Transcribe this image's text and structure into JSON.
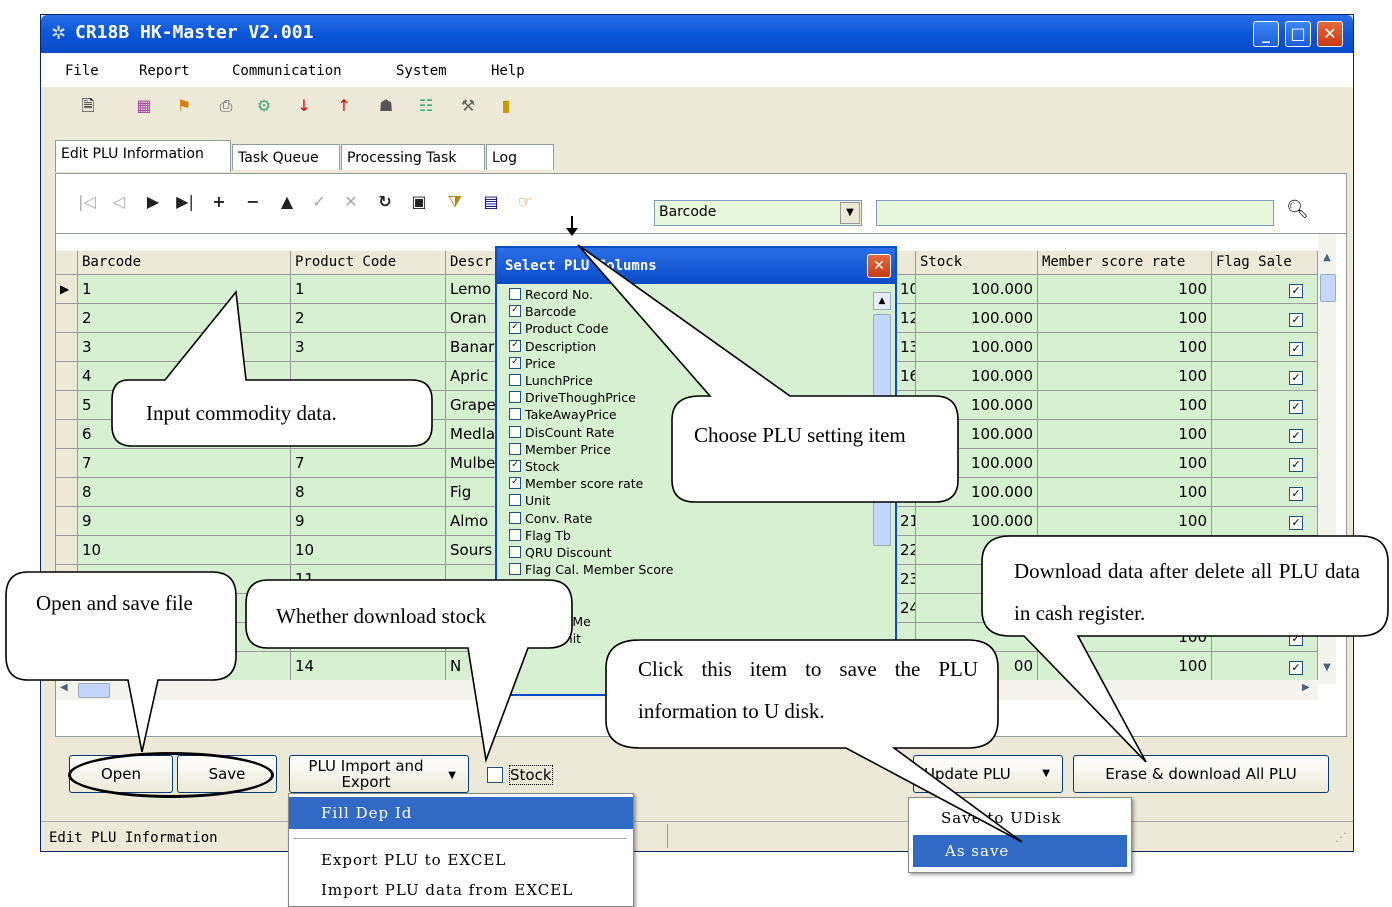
{
  "window": {
    "title": "CR18B HK-Master V2.001"
  },
  "menu": [
    "File",
    "Report",
    "Communication",
    "System",
    "Help"
  ],
  "tabs": [
    "Edit PLU Information",
    "Task Queue",
    "Processing Task",
    "Log"
  ],
  "search": {
    "field": "Barcode",
    "value": ""
  },
  "grid": {
    "columns": [
      "Barcode",
      "Product Code",
      "Descr",
      "Stock",
      "Member score rate",
      "Flag Sale"
    ],
    "rows": [
      {
        "barcode": "1",
        "code": "1",
        "desc": "Lemo",
        "mid": "10",
        "stock": "100.000",
        "rate": "100"
      },
      {
        "barcode": "2",
        "code": "2",
        "desc": "Oran",
        "mid": "12",
        "stock": "100.000",
        "rate": "100"
      },
      {
        "barcode": "3",
        "code": "3",
        "desc": "Banar",
        "mid": "13",
        "stock": "100.000",
        "rate": "100"
      },
      {
        "barcode": "4",
        "code": "",
        "desc": "Apric",
        "mid": "16",
        "stock": "100.000",
        "rate": "100"
      },
      {
        "barcode": "5",
        "code": "",
        "desc": "Grape",
        "mid": "",
        "stock": "100.000",
        "rate": "100"
      },
      {
        "barcode": "6",
        "code": "",
        "desc": "Medla",
        "mid": "",
        "stock": "100.000",
        "rate": "100"
      },
      {
        "barcode": "7",
        "code": "7",
        "desc": "Mulbe",
        "mid": "",
        "stock": "100.000",
        "rate": "100"
      },
      {
        "barcode": "8",
        "code": "8",
        "desc": "Fig",
        "mid": "",
        "stock": "100.000",
        "rate": "100"
      },
      {
        "barcode": "9",
        "code": "9",
        "desc": "Almo",
        "mid": "21",
        "stock": "100.000",
        "rate": "100"
      },
      {
        "barcode": "10",
        "code": "10",
        "desc": "Sours",
        "mid": "22",
        "stock": "10",
        "rate": ""
      },
      {
        "barcode": "",
        "code": "11",
        "desc": "",
        "mid": "23",
        "stock": "10",
        "rate": ""
      },
      {
        "barcode": "",
        "code": "",
        "desc": "",
        "mid": "24",
        "stock": "10",
        "rate": ""
      },
      {
        "barcode": "",
        "code": "",
        "desc": "",
        "mid": "",
        "stock": "",
        "rate": "100"
      },
      {
        "barcode": "",
        "code": "14",
        "desc": "N",
        "mid": "",
        "stock": "00",
        "rate": "100"
      }
    ]
  },
  "buttons": {
    "open": "Open",
    "save": "Save",
    "plu_import_export": "PLU Import and Export",
    "stock": "Stock",
    "update_plu": "Update PLU",
    "erase_download": "Erase & download All PLU"
  },
  "status": "Edit PLU Information",
  "dialog": {
    "title": "Select PLU Columns",
    "options": [
      {
        "label": "Record No.",
        "checked": false
      },
      {
        "label": "Barcode",
        "checked": true
      },
      {
        "label": "Product Code",
        "checked": true
      },
      {
        "label": "Description",
        "checked": true
      },
      {
        "label": "Price",
        "checked": true
      },
      {
        "label": "LunchPrice",
        "checked": false
      },
      {
        "label": "DriveThoughPrice",
        "checked": false
      },
      {
        "label": "TakeAwayPrice",
        "checked": false
      },
      {
        "label": "DisCount Rate",
        "checked": false
      },
      {
        "label": "Member Price",
        "checked": false
      },
      {
        "label": "Stock",
        "checked": true
      },
      {
        "label": "Member score rate",
        "checked": true
      },
      {
        "label": "Unit",
        "checked": false
      },
      {
        "label": "Conv. Rate",
        "checked": false
      },
      {
        "label": "Flag Tb",
        "checked": false
      },
      {
        "label": "QRU Discount",
        "checked": false
      },
      {
        "label": "Flag Cal. Member Score",
        "checked": false
      },
      {
        "label": "te",
        "checked": false
      },
      {
        "label": "turn",
        "checked": false
      },
      {
        "label": "ag Cal. Me",
        "checked": false
      },
      {
        "label": "tock Unit",
        "checked": false
      }
    ]
  },
  "import_menu": [
    "Fill Dep Id",
    "Export PLU to EXCEL",
    "Import PLU data from EXCEL"
  ],
  "update_menu": [
    "Save to UDisk",
    "As save"
  ],
  "callouts": {
    "input": "Input commodity data.",
    "choose": "Choose PLU setting item",
    "open_save": "Open and save file",
    "whether": "Whether download stock",
    "download": "Download data after delete all PLU data in cash register.",
    "click": "Click this item to save the PLU information to U disk."
  }
}
